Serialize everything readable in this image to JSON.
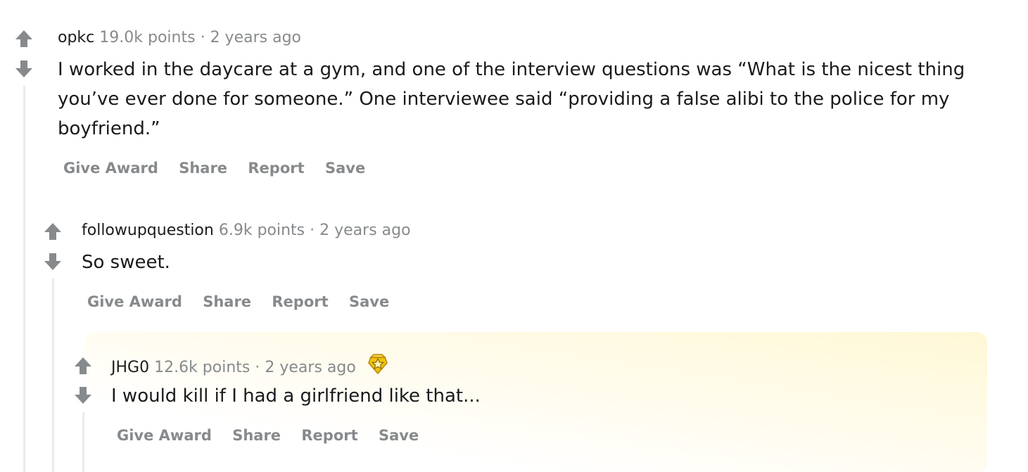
{
  "comments": [
    {
      "author": "opkc",
      "points": "19.0k points",
      "separator": "·",
      "time": "2 years ago",
      "body": "I worked in the daycare at a gym, and one of the interview questions was “What is the nicest thing you’ve ever done for someone.” One interviewee said “providing a false alibi to the police for my boyfriend.”",
      "actions": [
        "Give Award",
        "Share",
        "Report",
        "Save"
      ]
    },
    {
      "author": "followupquestion",
      "points": "6.9k points",
      "separator": "·",
      "time": "2 years ago",
      "body": "So sweet.",
      "actions": [
        "Give Award",
        "Share",
        "Report",
        "Save"
      ]
    },
    {
      "author": "JHG0",
      "points": "12.6k points",
      "separator": "·",
      "time": "2 years ago",
      "award_icon": "gold-award-icon",
      "body": "I would kill if I had a girlfriend like that...",
      "actions": [
        "Give Award",
        "Share",
        "Report",
        "Save"
      ]
    }
  ],
  "colors": {
    "arrow": "#878a8c",
    "meta_text": "#878a8c",
    "thread_line": "#ebebeb",
    "award_gold": "#f0c20c",
    "highlight": "#fff8d6"
  },
  "icons": {
    "upvote": "upvote-arrow-icon",
    "downvote": "downvote-arrow-icon"
  }
}
